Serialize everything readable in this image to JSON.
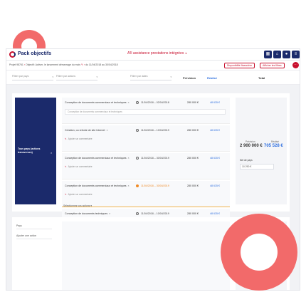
{
  "header": {
    "app_title": "Pack objectifs",
    "center_title": "A'll assistance prestations intégrées",
    "buttons": [
      "grid-icon",
      "cart-icon",
      "user-icon",
      "menu-icon"
    ]
  },
  "subbar": {
    "breadcrumbs": [
      "Projet 98761",
      "Objectif: Activer, le lancement démarrage du mois",
      "du 11/04/2018 au 30/04/2018"
    ],
    "btn_disponibilite": "Disponibilité financière",
    "btn_afficher": "Afficher les filtres"
  },
  "filters": {
    "pays": "Filtrer par pays",
    "actions": "Filtrer par actions",
    "dates": "Filtrer par dates",
    "col_prevision": "Prévision",
    "col_realise": "Réalisé",
    "col_total": "Total"
  },
  "group": {
    "label": "Tous pays (actions transverses)"
  },
  "rows": [
    {
      "name": "Conception de documents commerciaux et techniques",
      "dates": "11/04/2018 – 02/04/2018",
      "price": "280 000 €",
      "real": "48 635 €",
      "comment": "Conception de documents commerciaux et techniques",
      "add": "",
      "orange": false
    },
    {
      "name": "Création, ou refonte de site Internet",
      "dates": "11/04/2018 – 10/04/2019",
      "price": "280 000 €",
      "real": "48 635 €",
      "comment": "",
      "add": "Ajouter un commentaire",
      "orange": false
    },
    {
      "name": "Conception de documents commerciaux et techniques",
      "dates": "11/04/2018 – 30/04/2019",
      "price": "280 000 €",
      "real": "48 635 €",
      "comment": "",
      "add": "Ajouter un commentaire",
      "orange": false
    },
    {
      "name": "Conception de documents commerciaux et techniques",
      "dates": "11/04/2018 – 30/04/2019",
      "price": "280 000 €",
      "real": "48 635 €",
      "comment": "",
      "add": "Ajouter un commentaire",
      "orange": true
    },
    {
      "name": "Conception de documents techniques",
      "dates": "11/04/2018 – 10/04/2019",
      "price": "280 000 €",
      "real": "48 635 €",
      "comment": "",
      "add": "Ajouter un commentaire",
      "orange": false
    }
  ],
  "select_all": "Sélectionnez vos actions",
  "summary": {
    "prevision_label": "Prévision",
    "prevision_value": "2 900 000 €",
    "realise_label": "Réalisé",
    "realise_value": "705 528 €",
    "budget_label": "Net de pays",
    "budget_value": "10 290 €"
  },
  "panel2": {
    "label1": "Pays",
    "label2": "Ajouter une action"
  },
  "colors": {
    "brand": "#1b2a6b",
    "accent": "#c8102e",
    "real": "#2f6fdf",
    "warning": "#f08a24"
  }
}
